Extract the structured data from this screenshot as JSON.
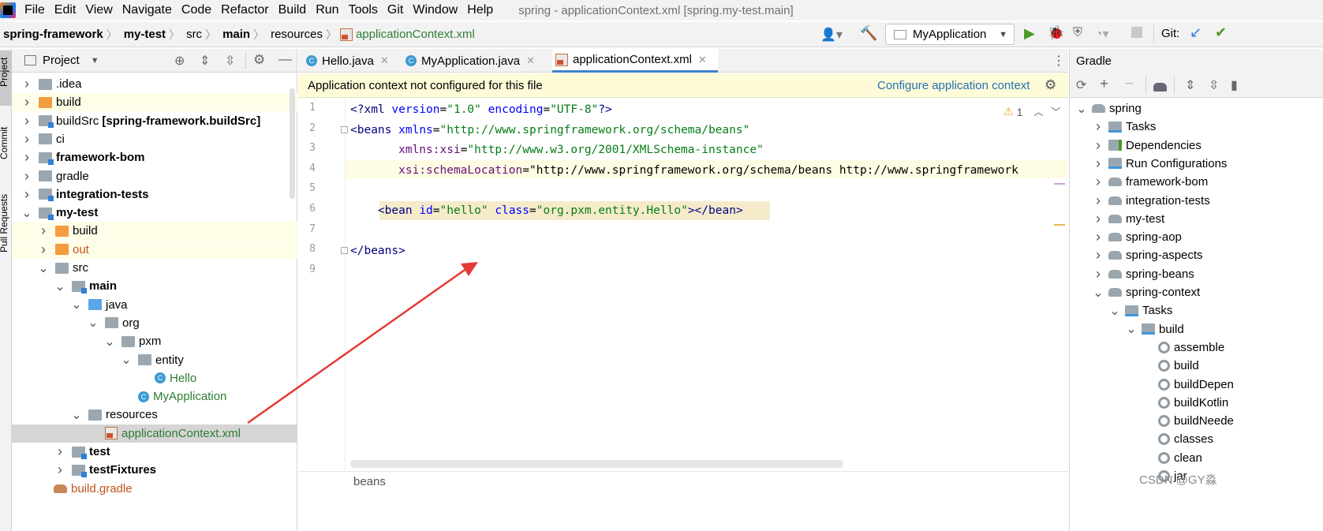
{
  "menu": {
    "items": [
      "File",
      "Edit",
      "View",
      "Navigate",
      "Code",
      "Refactor",
      "Build",
      "Run",
      "Tools",
      "Git",
      "Window",
      "Help"
    ],
    "window_title": "spring - applicationContext.xml [spring.my-test.main]"
  },
  "breadcrumb": [
    "spring-framework",
    "my-test",
    "src",
    "main",
    "resources",
    "applicationContext.xml"
  ],
  "run_config": "MyApplication",
  "git_label": "Git:",
  "side_tabs": [
    "Project",
    "Commit",
    "Pull Requests"
  ],
  "project_panel": {
    "title": "Project",
    "tree": [
      {
        "label": "idea",
        "prefix": ".",
        "depth": 1,
        "icon": "folder-gray",
        "arrow": "right"
      },
      {
        "label": "build",
        "depth": 1,
        "icon": "folder-orange",
        "arrow": "right",
        "hl": true
      },
      {
        "label": "buildSrc [spring-framework.buildSrc]",
        "prefix": "buildSrc ",
        "bold": "[spring-framework.buildSrc]",
        "depth": 1,
        "icon": "folder-module",
        "arrow": "right"
      },
      {
        "label": "ci",
        "depth": 1,
        "icon": "folder-gray",
        "arrow": "right"
      },
      {
        "label": "framework-bom",
        "depth": 1,
        "icon": "folder-module",
        "arrow": "right",
        "bold_all": true
      },
      {
        "label": "gradle",
        "depth": 1,
        "icon": "folder-gray",
        "arrow": "right"
      },
      {
        "label": "integration-tests",
        "depth": 1,
        "icon": "folder-module",
        "arrow": "right",
        "bold_all": true
      },
      {
        "label": "my-test",
        "depth": 1,
        "icon": "folder-module",
        "arrow": "down",
        "bold_all": true
      },
      {
        "label": "build",
        "depth": 2,
        "icon": "folder-orange",
        "arrow": "right",
        "hl": true
      },
      {
        "label": "out",
        "depth": 2,
        "icon": "folder-orange",
        "arrow": "right",
        "hl": true,
        "color": "brown"
      },
      {
        "label": "src",
        "depth": 2,
        "icon": "folder-gray",
        "arrow": "down"
      },
      {
        "label": "main",
        "depth": 3,
        "icon": "folder-module",
        "arrow": "down",
        "bold_all": true
      },
      {
        "label": "java",
        "depth": 4,
        "icon": "folder-blue",
        "arrow": "down"
      },
      {
        "label": "org",
        "depth": 5,
        "icon": "folder-gray",
        "arrow": "down"
      },
      {
        "label": "pxm",
        "depth": 6,
        "icon": "folder-gray",
        "arrow": "down"
      },
      {
        "label": "entity",
        "depth": 7,
        "icon": "folder-gray",
        "arrow": "down"
      },
      {
        "label": "Hello",
        "depth": 8,
        "icon": "class",
        "arrow": "none",
        "color": "green"
      },
      {
        "label": "MyApplication",
        "depth": 7,
        "icon": "class",
        "arrow": "none",
        "color": "green"
      },
      {
        "label": "resources",
        "depth": 4,
        "icon": "folder-res",
        "arrow": "down"
      },
      {
        "label": "applicationContext.xml",
        "depth": 5,
        "icon": "xml",
        "arrow": "none",
        "color": "green",
        "selected": true
      },
      {
        "label": "test",
        "depth": 3,
        "icon": "folder-module",
        "arrow": "right",
        "bold_all": true
      },
      {
        "label": "testFixtures",
        "depth": 3,
        "icon": "folder-module",
        "arrow": "right",
        "bold_all": true
      },
      {
        "label": "build.gradle",
        "depth": 2,
        "icon": "gradle",
        "arrow": "none",
        "color": "brown"
      }
    ]
  },
  "editor_tabs": [
    {
      "label": "Hello.java",
      "active": false
    },
    {
      "label": "MyApplication.java",
      "active": false
    },
    {
      "label": "applicationContext.xml",
      "active": true
    }
  ],
  "banner": {
    "message": "Application context not configured for this file",
    "action": "Configure application context"
  },
  "inspection": {
    "warnings": "1"
  },
  "line_numbers": [
    "1",
    "2",
    "3",
    "4",
    "5",
    "6",
    "7",
    "8",
    "9"
  ],
  "code_lines": [
    "<?xml version=\"1.0\" encoding=\"UTF-8\"?>",
    "<beans xmlns=\"http://www.springframework.org/schema/beans\"",
    "       xmlns:xsi=\"http://www.w3.org/2001/XMLSchema-instance\"",
    "       xsi:schemaLocation=\"http://www.springframework.org/schema/beans http://www.springframework",
    "",
    "    <bean id=\"hello\" class=\"org.pxm.entity.Hello\"></bean>",
    "",
    "</beans>",
    ""
  ],
  "status_breadcrumb": "beans",
  "gradle": {
    "title": "Gradle",
    "tree": [
      {
        "label": "spring",
        "depth": 0,
        "icon": "elephant",
        "arrow": "down"
      },
      {
        "label": "Tasks",
        "depth": 1,
        "icon": "folder-gear",
        "arrow": "right"
      },
      {
        "label": "Dependencies",
        "depth": 1,
        "icon": "deps",
        "arrow": "right"
      },
      {
        "label": "Run Configurations",
        "depth": 1,
        "icon": "folder-gear",
        "arrow": "right"
      },
      {
        "label": "framework-bom",
        "depth": 1,
        "icon": "elephant",
        "arrow": "right"
      },
      {
        "label": "integration-tests",
        "depth": 1,
        "icon": "elephant",
        "arrow": "right"
      },
      {
        "label": "my-test",
        "depth": 1,
        "icon": "elephant",
        "arrow": "right"
      },
      {
        "label": "spring-aop",
        "depth": 1,
        "icon": "elephant",
        "arrow": "right"
      },
      {
        "label": "spring-aspects",
        "depth": 1,
        "icon": "elephant",
        "arrow": "right"
      },
      {
        "label": "spring-beans",
        "depth": 1,
        "icon": "elephant",
        "arrow": "right"
      },
      {
        "label": "spring-context",
        "depth": 1,
        "icon": "elephant",
        "arrow": "down"
      },
      {
        "label": "Tasks",
        "depth": 2,
        "icon": "folder-gear",
        "arrow": "down"
      },
      {
        "label": "build",
        "depth": 3,
        "icon": "folder-gear",
        "arrow": "down"
      },
      {
        "label": "assemble",
        "depth": 4,
        "icon": "gear",
        "arrow": "none"
      },
      {
        "label": "build",
        "depth": 4,
        "icon": "gear",
        "arrow": "none"
      },
      {
        "label": "buildDepen",
        "depth": 4,
        "icon": "gear",
        "arrow": "none"
      },
      {
        "label": "buildKotlin",
        "depth": 4,
        "icon": "gear",
        "arrow": "none"
      },
      {
        "label": "buildNeede",
        "depth": 4,
        "icon": "gear",
        "arrow": "none"
      },
      {
        "label": "classes",
        "depth": 4,
        "icon": "gear",
        "arrow": "none"
      },
      {
        "label": "clean",
        "depth": 4,
        "icon": "gear",
        "arrow": "none"
      },
      {
        "label": "jar",
        "depth": 4,
        "icon": "gear",
        "arrow": "none"
      }
    ]
  },
  "watermark": "CSDN @GY淼"
}
